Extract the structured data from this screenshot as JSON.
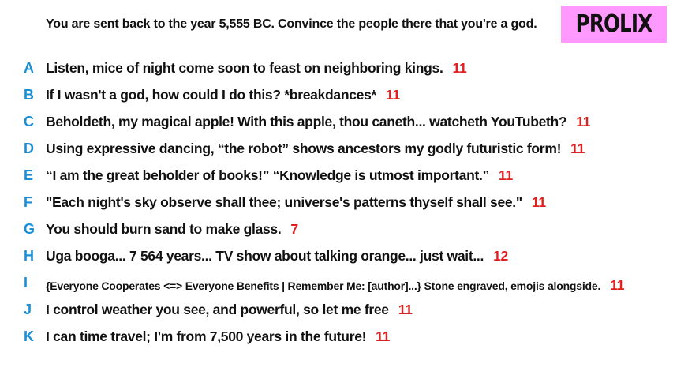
{
  "prompt": "You are sent back to the year 5,555 BC. Convince the people there that you're a god.",
  "brand": "PROLIX",
  "colors": {
    "letter": "#1a8fd6",
    "score": "#e02020",
    "brand_bg": "#ff99ff",
    "text": "#111111"
  },
  "answers": [
    {
      "letter": "A",
      "text": "Listen, mice of night come soon to feast on neighboring kings.",
      "score": "11"
    },
    {
      "letter": "B",
      "text": "If I wasn't a god, how could I do this? *breakdances*",
      "score": "11"
    },
    {
      "letter": "C",
      "text": "Beholdeth, my magical apple! With this apple, thou caneth... watcheth YouTubeth?",
      "score": "11"
    },
    {
      "letter": "D",
      "text": "Using expressive dancing, “the robot” shows ancestors my godly futuristic form!",
      "score": "11"
    },
    {
      "letter": "E",
      "text": "“I am the great beholder of books!” “Knowledge is utmost important.”",
      "score": "11"
    },
    {
      "letter": "F",
      "text": "\"Each night's sky observe shall thee; universe's patterns thyself shall see.\"",
      "score": "11"
    },
    {
      "letter": "G",
      "text": "You should burn sand to make glass.",
      "score": "7"
    },
    {
      "letter": "H",
      "text": "Uga booga... 7 564 years... TV show about talking orange... just wait...",
      "score": "12"
    },
    {
      "letter": "I",
      "text": "{Everyone Cooperates <=> Everyone Benefits | Remember Me: [author]...} Stone engraved, emojis alongside.",
      "score": "11"
    },
    {
      "letter": "J",
      "text": "I control weather you see, and powerful, so let me free",
      "score": "11"
    },
    {
      "letter": "K",
      "text": "I can time travel; I'm from 7,500 years in the future!",
      "score": "11"
    }
  ]
}
